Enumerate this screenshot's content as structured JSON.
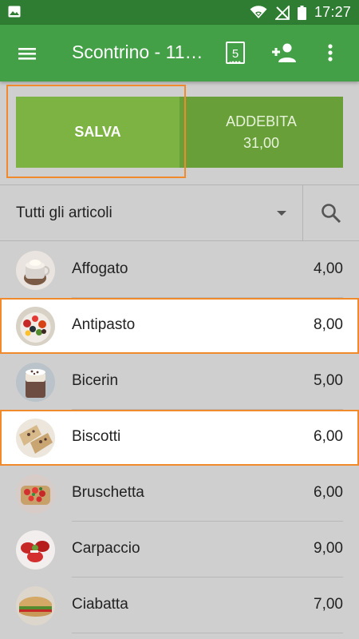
{
  "status_bar": {
    "time": "17:27",
    "icons": [
      "image-icon",
      "wifi-icon",
      "no-signal-icon",
      "battery-icon"
    ]
  },
  "toolbar": {
    "title": "Scontrino - 11…",
    "receipt_count": "5",
    "icons": [
      "menu-icon",
      "receipt-icon",
      "add-person-icon",
      "more-vert-icon"
    ]
  },
  "actions": {
    "save_label": "SALVA",
    "charge_label": "ADDEBITA",
    "charge_amount": "31,00"
  },
  "filter": {
    "category": "Tutti gli articoli"
  },
  "items": [
    {
      "name": "Affogato",
      "price": "4,00",
      "selected": false
    },
    {
      "name": "Antipasto",
      "price": "8,00",
      "selected": true
    },
    {
      "name": "Bicerin",
      "price": "5,00",
      "selected": false
    },
    {
      "name": "Biscotti",
      "price": "6,00",
      "selected": true
    },
    {
      "name": "Bruschetta",
      "price": "6,00",
      "selected": false
    },
    {
      "name": "Carpaccio",
      "price": "9,00",
      "selected": false
    },
    {
      "name": "Ciabatta",
      "price": "7,00",
      "selected": false
    }
  ],
  "colors": {
    "toolbar": "#43a047",
    "status_bar": "#2e7d32",
    "save_button": "#7cb342",
    "charge_button": "#689f38",
    "highlight": "#f08a2c"
  }
}
